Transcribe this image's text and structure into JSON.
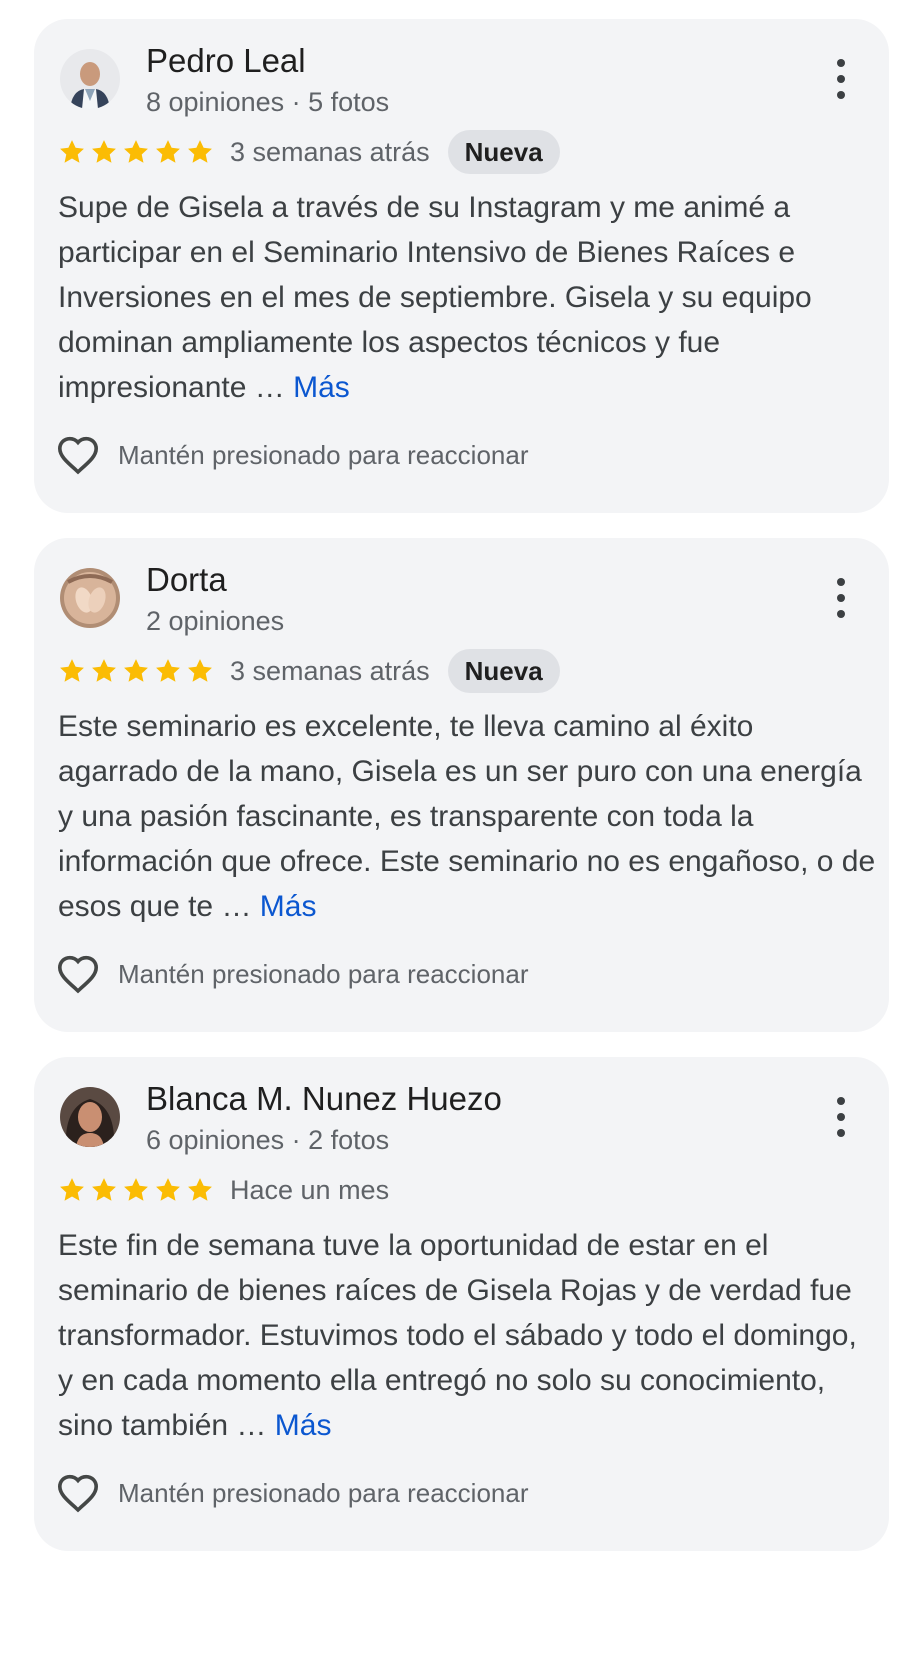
{
  "reviews": [
    {
      "name": "Pedro Leal",
      "meta": "8 opiniones · 5 fotos",
      "rating": 5,
      "date": "3 semanas atrás",
      "badge": "Nueva",
      "text": "Supe de Gisela a través de su Instagram y me animé a participar en el Seminario Intensivo de Bienes Raíces e Inversiones en el mes de septiembre. Gisela y su equipo dominan ampliamente los aspectos técnicos y fue impresionante …",
      "more_label": "Más",
      "react_label": "Mantén presionado para reaccionar"
    },
    {
      "name": "Dorta",
      "meta": "2 opiniones",
      "rating": 5,
      "date": "3 semanas atrás",
      "badge": "Nueva",
      "text": "Este seminario es excelente, te lleva camino al éxito agarrado de la mano, Gisela es un ser puro con una energía y una pasión fascinante, es transparente con toda la información que ofrece. Este seminario no es engañoso, o de esos que te …",
      "more_label": "Más",
      "react_label": "Mantén presionado para reaccionar"
    },
    {
      "name": "Blanca M. Nunez Huezo",
      "meta": "6 opiniones · 2 fotos",
      "rating": 5,
      "date": "Hace un mes",
      "text": "Este fin de semana tuve la oportunidad de estar en el seminario de bienes raíces de Gisela Rojas y de verdad fue transformador. Estuvimos todo el sábado y todo el domingo, y en cada momento ella entregó no solo su conocimiento, sino también …",
      "more_label": "Más",
      "react_label": "Mantén presionado para reaccionar"
    }
  ],
  "colors": {
    "card_bg": "#f3f4f6",
    "star": "#fbbc04",
    "link": "#0b57d0",
    "badge_bg": "#dfe1e5",
    "secondary_text": "#5f6368"
  },
  "icons": {
    "star": "star-icon",
    "more": "more-vert-icon",
    "heart": "heart-outline-icon"
  }
}
